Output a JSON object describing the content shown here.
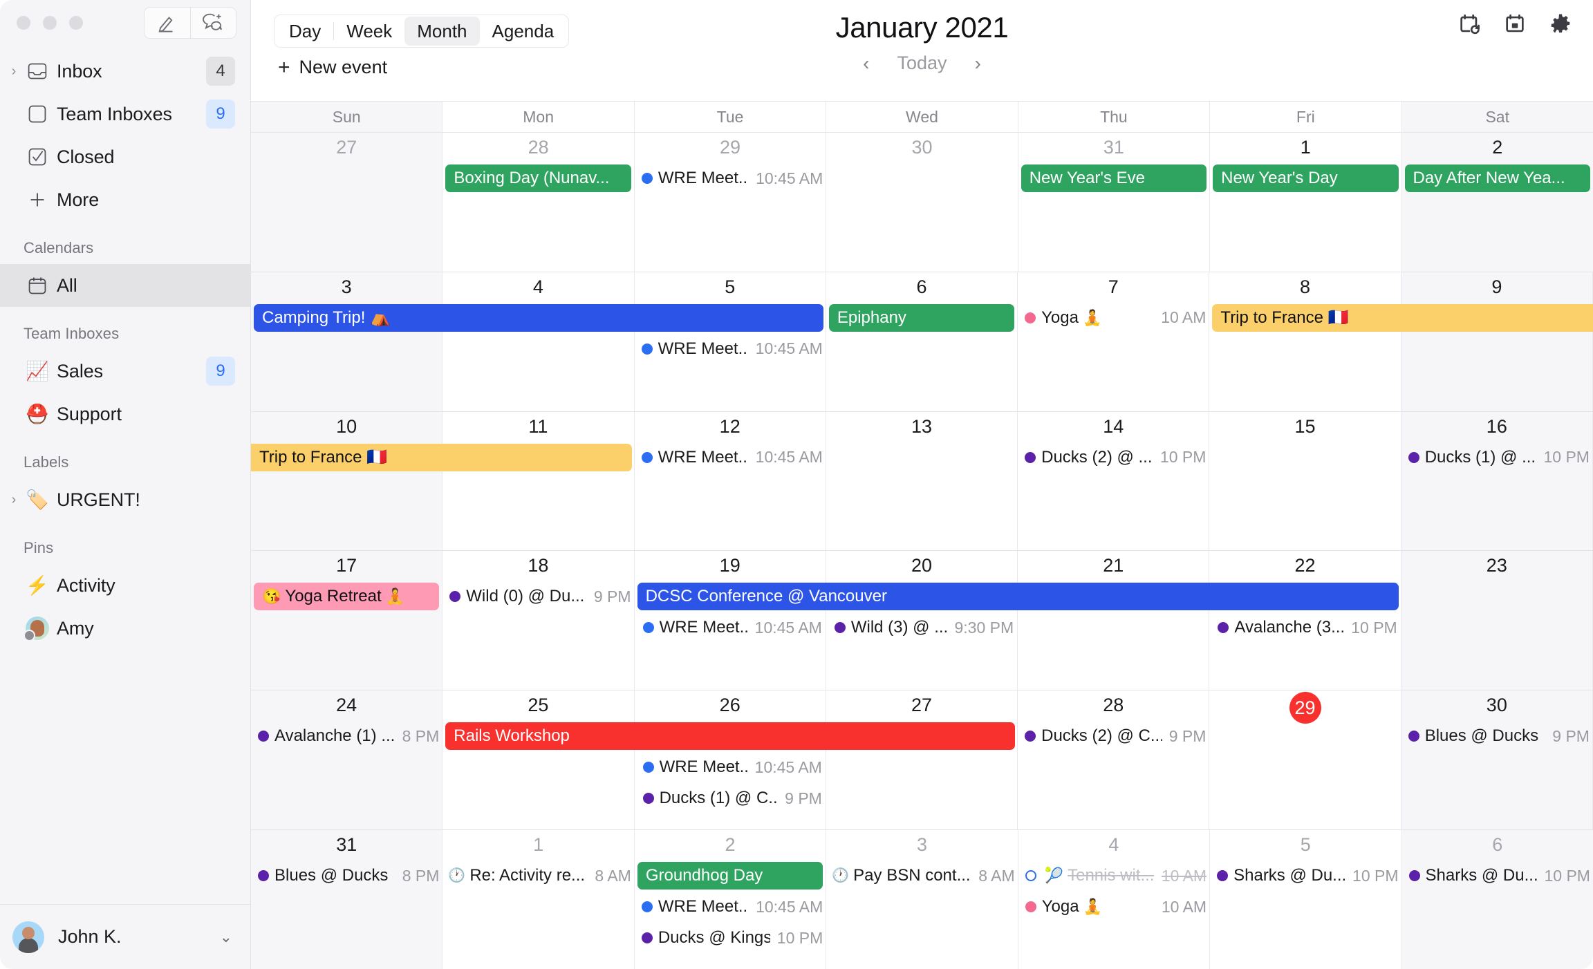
{
  "sidebar": {
    "titlebar_buttons": [
      {
        "name": "compose-button",
        "icon": "pencil-icon"
      },
      {
        "name": "new-conversation-button",
        "icon": "chat-plus-icon"
      }
    ],
    "nav": [
      {
        "label": "Inbox",
        "icon": "inbox-icon",
        "badge": "4",
        "badge_style": "gray",
        "twisty": true
      },
      {
        "label": "Team Inboxes",
        "icon": "square-icon",
        "badge": "9",
        "badge_style": "blue",
        "twisty": false
      },
      {
        "label": "Closed",
        "icon": "check-square-icon",
        "badge": "",
        "badge_style": "",
        "twisty": false
      },
      {
        "label": "More",
        "icon": "plus-icon",
        "badge": "",
        "badge_style": "",
        "twisty": false
      }
    ],
    "sections": [
      {
        "heading": "Calendars",
        "items": [
          {
            "label": "All",
            "icon": "calendar-icon",
            "badge": "",
            "selected": true,
            "twisty": false
          }
        ]
      },
      {
        "heading": "Team Inboxes",
        "items": [
          {
            "label": "Sales",
            "icon": "📈",
            "badge": "9",
            "badge_style": "blue",
            "selected": false,
            "twisty": false
          },
          {
            "label": "Support",
            "icon": "⛑️",
            "badge": "",
            "selected": false,
            "twisty": false
          }
        ]
      },
      {
        "heading": "Labels",
        "items": [
          {
            "label": "URGENT!",
            "icon": "🏷️",
            "badge": "",
            "selected": false,
            "twisty": true
          }
        ]
      },
      {
        "heading": "Pins",
        "items": [
          {
            "label": "Activity",
            "icon": "⚡",
            "badge": "",
            "selected": false,
            "twisty": false
          },
          {
            "label": "Amy",
            "icon": "avatar-amy",
            "badge": "",
            "selected": false,
            "twisty": false
          }
        ]
      }
    ],
    "user": {
      "name": "John K.",
      "chevron": "chevron-down-icon"
    }
  },
  "toolbar": {
    "views": [
      {
        "label": "Day",
        "active": false
      },
      {
        "label": "Week",
        "active": false
      },
      {
        "label": "Month",
        "active": true
      },
      {
        "label": "Agenda",
        "active": false
      }
    ],
    "new_event_label": "New event",
    "title": "January 2021",
    "today_label": "Today",
    "prev_label": "‹",
    "next_label": "›",
    "icons": [
      {
        "name": "calendar-refresh-icon"
      },
      {
        "name": "calendar-day-icon"
      },
      {
        "name": "gear-icon"
      }
    ]
  },
  "calendar": {
    "day_names": [
      "Sun",
      "Mon",
      "Tue",
      "Wed",
      "Thu",
      "Fri",
      "Sat"
    ],
    "colors": {
      "green": "#2fa360",
      "blue": "#2c55e8",
      "yellow": "#fbd06a",
      "pink": "#ff9ab5",
      "red": "#f8312f",
      "purple": "#5b21a8",
      "dot_blue": "#2c6ef2",
      "dot_purple": "#5b21a8",
      "dot_pink": "#f4678f",
      "today_pill": "#f8312f"
    },
    "weeks": [
      {
        "days": [
          {
            "num": "27",
            "muted": true,
            "weekend": true,
            "today": false,
            "events": []
          },
          {
            "num": "28",
            "muted": true,
            "weekend": false,
            "today": false,
            "events": [
              {
                "kind": "chip",
                "title": "Boxing Day (Nunav...",
                "color": "green",
                "text": "light"
              }
            ]
          },
          {
            "num": "29",
            "muted": true,
            "weekend": false,
            "today": false,
            "events": [
              {
                "kind": "dot",
                "title": "WRE Meet...",
                "time": "10:45 AM",
                "dot": "dot_blue"
              }
            ]
          },
          {
            "num": "30",
            "muted": true,
            "weekend": false,
            "today": false,
            "events": []
          },
          {
            "num": "31",
            "muted": true,
            "weekend": false,
            "today": false,
            "events": [
              {
                "kind": "chip",
                "title": "New Year's Eve",
                "color": "green",
                "text": "light"
              }
            ]
          },
          {
            "num": "1",
            "muted": false,
            "weekend": false,
            "today": false,
            "events": [
              {
                "kind": "chip",
                "title": "New Year's Day",
                "color": "green",
                "text": "light"
              }
            ]
          },
          {
            "num": "2",
            "muted": false,
            "weekend": true,
            "today": false,
            "events": [
              {
                "kind": "chip",
                "title": "Day After New Yea...",
                "color": "green",
                "text": "light"
              }
            ]
          }
        ],
        "spans": [
          {
            "title": "",
            "start": 0,
            "end": 0,
            "color": "",
            "text": "",
            "row": -1
          }
        ]
      },
      {
        "days": [
          {
            "num": "3",
            "muted": false,
            "weekend": true,
            "today": false,
            "events": []
          },
          {
            "num": "4",
            "muted": false,
            "weekend": false,
            "today": false,
            "events": []
          },
          {
            "num": "5",
            "muted": false,
            "weekend": false,
            "today": false,
            "events": [
              {
                "kind": "dot",
                "title": "WRE Meet...",
                "time": "10:45 AM",
                "dot": "dot_blue"
              }
            ]
          },
          {
            "num": "6",
            "muted": false,
            "weekend": false,
            "today": false,
            "events": [
              {
                "kind": "chip",
                "title": "Epiphany",
                "color": "green",
                "text": "light"
              }
            ]
          },
          {
            "num": "7",
            "muted": false,
            "weekend": false,
            "today": false,
            "events": [
              {
                "kind": "dot",
                "title": "Yoga",
                "emoji": "🧘",
                "time": "10 AM",
                "dot": "dot_pink"
              }
            ]
          },
          {
            "num": "8",
            "muted": false,
            "weekend": false,
            "today": false,
            "events": []
          },
          {
            "num": "9",
            "muted": false,
            "weekend": true,
            "today": false,
            "events": []
          }
        ],
        "spans": [
          {
            "title": "Camping Trip! ⛺",
            "start": 0,
            "end": 2,
            "color": "blue",
            "text": "light",
            "row": 0,
            "round": "both"
          },
          {
            "title": "Trip to France 🇫🇷",
            "start": 5,
            "end": 6,
            "color": "yellow",
            "text": "dark",
            "row": 0,
            "round": "left"
          }
        ]
      },
      {
        "days": [
          {
            "num": "10",
            "muted": false,
            "weekend": true,
            "today": false,
            "events": []
          },
          {
            "num": "11",
            "muted": false,
            "weekend": false,
            "today": false,
            "events": []
          },
          {
            "num": "12",
            "muted": false,
            "weekend": false,
            "today": false,
            "events": [
              {
                "kind": "dot",
                "title": "WRE Meet...",
                "time": "10:45 AM",
                "dot": "dot_blue"
              }
            ]
          },
          {
            "num": "13",
            "muted": false,
            "weekend": false,
            "today": false,
            "events": []
          },
          {
            "num": "14",
            "muted": false,
            "weekend": false,
            "today": false,
            "events": [
              {
                "kind": "dot",
                "title": "Ducks (2) @ ...",
                "time": "10 PM",
                "dot": "dot_purple"
              }
            ]
          },
          {
            "num": "15",
            "muted": false,
            "weekend": false,
            "today": false,
            "events": []
          },
          {
            "num": "16",
            "muted": false,
            "weekend": true,
            "today": false,
            "events": [
              {
                "kind": "dot",
                "title": "Ducks (1) @ ...",
                "time": "10 PM",
                "dot": "dot_purple"
              }
            ]
          }
        ],
        "spans": [
          {
            "title": "Trip to France 🇫🇷",
            "start": 0,
            "end": 1,
            "color": "yellow",
            "text": "dark",
            "row": 0,
            "round": "right"
          }
        ]
      },
      {
        "days": [
          {
            "num": "17",
            "muted": false,
            "weekend": true,
            "today": false,
            "events": [
              {
                "kind": "chip",
                "title": "Yoga Retreat",
                "emoji_pre": "😘",
                "emoji": "🧘",
                "color": "pink",
                "text": "dark"
              }
            ]
          },
          {
            "num": "18",
            "muted": false,
            "weekend": false,
            "today": false,
            "events": [
              {
                "kind": "dot",
                "title": "Wild (0) @ Du...",
                "time": "9 PM",
                "dot": "dot_purple"
              }
            ]
          },
          {
            "num": "19",
            "muted": false,
            "weekend": false,
            "today": false,
            "events": []
          },
          {
            "num": "20",
            "muted": false,
            "weekend": false,
            "today": false,
            "events": []
          },
          {
            "num": "21",
            "muted": false,
            "weekend": false,
            "today": false,
            "events": []
          },
          {
            "num": "22",
            "muted": false,
            "weekend": false,
            "today": false,
            "events": []
          },
          {
            "num": "23",
            "muted": false,
            "weekend": true,
            "today": false,
            "events": []
          }
        ],
        "spans": [
          {
            "title": "DCSC Conference @ Vancouver",
            "start": 2,
            "end": 5,
            "color": "blue",
            "text": "light",
            "row": 0,
            "round": "both"
          },
          {
            "title": "WRE Meet...",
            "start": 2,
            "end": 2,
            "color": "",
            "text": "",
            "row": 1,
            "kind": "dot",
            "time": "10:45 AM",
            "dot": "dot_blue"
          },
          {
            "title": "Wild (3) @ ...",
            "start": 3,
            "end": 3,
            "color": "",
            "text": "",
            "row": 1,
            "kind": "dot",
            "time": "9:30 PM",
            "dot": "dot_purple"
          },
          {
            "title": "Avalanche (3...",
            "start": 5,
            "end": 5,
            "color": "",
            "text": "",
            "row": 1,
            "kind": "dot",
            "time": "10 PM",
            "dot": "dot_purple"
          }
        ]
      },
      {
        "days": [
          {
            "num": "24",
            "muted": false,
            "weekend": true,
            "today": false,
            "events": [
              {
                "kind": "dot",
                "title": "Avalanche (1) ...",
                "time": "8 PM",
                "dot": "dot_purple"
              }
            ]
          },
          {
            "num": "25",
            "muted": false,
            "weekend": false,
            "today": false,
            "events": []
          },
          {
            "num": "26",
            "muted": false,
            "weekend": false,
            "today": false,
            "events": []
          },
          {
            "num": "27",
            "muted": false,
            "weekend": false,
            "today": false,
            "events": []
          },
          {
            "num": "28",
            "muted": false,
            "weekend": false,
            "today": false,
            "events": [
              {
                "kind": "dot",
                "title": "Ducks (2) @ C...",
                "time": "9 PM",
                "dot": "dot_purple"
              }
            ]
          },
          {
            "num": "29",
            "muted": false,
            "weekend": false,
            "today": true,
            "events": []
          },
          {
            "num": "30",
            "muted": false,
            "weekend": true,
            "today": false,
            "events": [
              {
                "kind": "dot",
                "title": "Blues @ Ducks",
                "time": "9 PM",
                "dot": "dot_purple"
              }
            ]
          }
        ],
        "spans": [
          {
            "title": "Rails Workshop",
            "start": 1,
            "end": 3,
            "color": "red",
            "text": "light",
            "row": 0,
            "round": "both"
          },
          {
            "title": "WRE Meet...",
            "start": 2,
            "end": 2,
            "color": "",
            "text": "",
            "row": 1,
            "kind": "dot",
            "time": "10:45 AM",
            "dot": "dot_blue"
          },
          {
            "title": "Ducks (1) @ C...",
            "start": 2,
            "end": 2,
            "color": "",
            "text": "",
            "row": 2,
            "kind": "dot",
            "time": "9 PM",
            "dot": "dot_purple"
          }
        ]
      },
      {
        "days": [
          {
            "num": "31",
            "muted": false,
            "weekend": true,
            "today": false,
            "events": [
              {
                "kind": "dot",
                "title": "Blues @ Ducks",
                "time": "8 PM",
                "dot": "dot_purple"
              }
            ]
          },
          {
            "num": "1",
            "muted": true,
            "weekend": false,
            "today": false,
            "events": [
              {
                "kind": "task",
                "title": "Re: Activity re...",
                "time": "8 AM",
                "clock": "🕐"
              }
            ]
          },
          {
            "num": "2",
            "muted": true,
            "weekend": false,
            "today": false,
            "events": [
              {
                "kind": "chip",
                "title": "Groundhog Day",
                "color": "green",
                "text": "light"
              },
              {
                "kind": "dot",
                "title": "WRE Meet...",
                "time": "10:45 AM",
                "dot": "dot_blue"
              },
              {
                "kind": "dot",
                "title": "Ducks @ Kings",
                "time": "10 PM",
                "dot": "dot_purple"
              }
            ]
          },
          {
            "num": "3",
            "muted": true,
            "weekend": false,
            "today": false,
            "events": [
              {
                "kind": "task",
                "title": "Pay BSN cont...",
                "time": "8 AM",
                "clock": "🕐"
              }
            ]
          },
          {
            "num": "4",
            "muted": true,
            "weekend": false,
            "today": false,
            "events": [
              {
                "kind": "dot",
                "title": "Tennis wit...",
                "emoji_pre": "🎾",
                "time": "10 AM",
                "dot": "dot_blue",
                "hollow": true,
                "struck": true
              },
              {
                "kind": "dot",
                "title": "Yoga",
                "emoji": "🧘",
                "time": "10 AM",
                "dot": "dot_pink"
              }
            ]
          },
          {
            "num": "5",
            "muted": true,
            "weekend": false,
            "today": false,
            "events": [
              {
                "kind": "dot",
                "title": "Sharks @ Du...",
                "time": "10 PM",
                "dot": "dot_purple"
              }
            ]
          },
          {
            "num": "6",
            "muted": true,
            "weekend": true,
            "today": false,
            "events": [
              {
                "kind": "dot",
                "title": "Sharks @ Du...",
                "time": "10 PM",
                "dot": "dot_purple"
              }
            ]
          }
        ],
        "spans": []
      }
    ]
  }
}
